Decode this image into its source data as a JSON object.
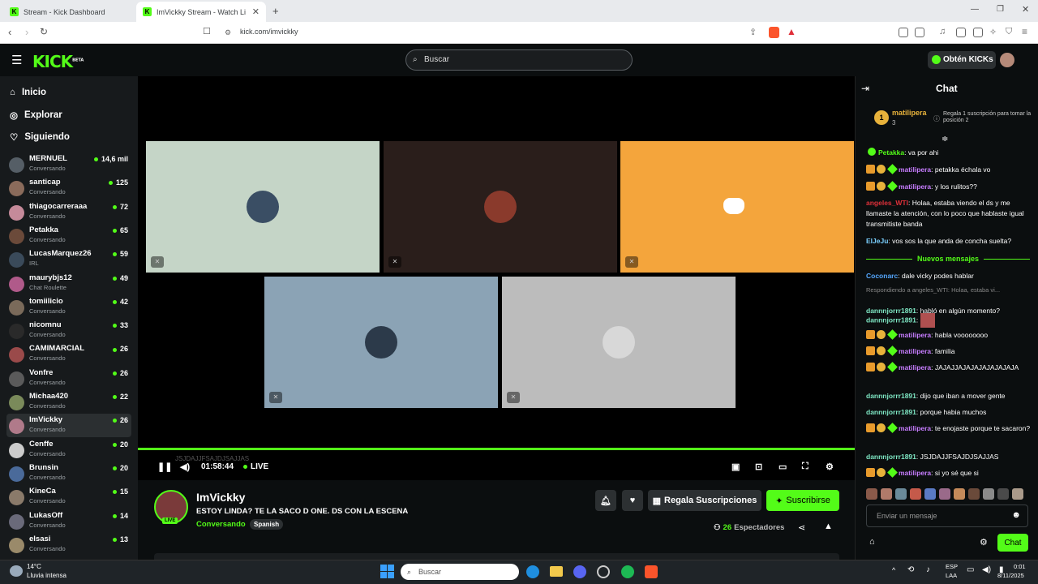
{
  "browser": {
    "tabs": [
      {
        "title": "Stream - Kick Dashboard"
      },
      {
        "title": "ImVickky Stream - Watch Live"
      }
    ],
    "url": "kick.com/imvickky",
    "new_tab": "+"
  },
  "header": {
    "logo": "KICK",
    "logo_badge": "BETA",
    "search_placeholder": "Buscar",
    "get_kicks": "Obtén KICKs"
  },
  "sidebar": {
    "nav": [
      {
        "label": "Inicio",
        "icon": "home-icon"
      },
      {
        "label": "Explorar",
        "icon": "compass-icon"
      },
      {
        "label": "Siguiendo",
        "icon": "heart-icon"
      }
    ],
    "channels": [
      {
        "name": "MERNUEL",
        "category": "Conversando",
        "viewers": "14,6 mil"
      },
      {
        "name": "santicap",
        "category": "Conversando",
        "viewers": "125"
      },
      {
        "name": "thiagocarreraaa",
        "category": "Conversando",
        "viewers": "72"
      },
      {
        "name": "Petakka",
        "category": "Conversando",
        "viewers": "65"
      },
      {
        "name": "LucasMarquez26",
        "category": "IRL",
        "viewers": "59"
      },
      {
        "name": "maurybjs12",
        "category": "Chat Roulette",
        "viewers": "49"
      },
      {
        "name": "tomiilicio",
        "category": "Conversando",
        "viewers": "42"
      },
      {
        "name": "nicomnu",
        "category": "Conversando",
        "viewers": "33"
      },
      {
        "name": "CAMIMARCIAL",
        "category": "Conversando",
        "viewers": "26"
      },
      {
        "name": "Vonfre",
        "category": "Conversando",
        "viewers": "26"
      },
      {
        "name": "Michaa420",
        "category": "Conversando",
        "viewers": "22"
      },
      {
        "name": "ImVickky",
        "category": "Conversando",
        "viewers": "26"
      },
      {
        "name": "Cenffe",
        "category": "Conversando",
        "viewers": "20"
      },
      {
        "name": "Brunsin",
        "category": "Conversando",
        "viewers": "20"
      },
      {
        "name": "KineCa",
        "category": "Conversando",
        "viewers": "15"
      },
      {
        "name": "LukasOff",
        "category": "Conversando",
        "viewers": "14"
      },
      {
        "name": "elsasi",
        "category": "Conversando",
        "viewers": "13"
      }
    ]
  },
  "player": {
    "time": "01:58:44",
    "live_label": "LIVE",
    "overlay_text": "JSJDAJJFSAJDJSAJJAS"
  },
  "stream": {
    "channel_name": "ImVickky",
    "title": "ESTOY LINDA? TE LA SACO D ONE. DS CON LA ESCENA",
    "category": "Conversando",
    "language": "Spanish",
    "live_badge": "LIVE",
    "gift_subs": "Regala Suscripciones",
    "subscribe": "Suscribirse",
    "viewers_count": "26",
    "viewers_label": "Espectadores"
  },
  "chat": {
    "title": "Chat",
    "top_gifter": {
      "rank": "1",
      "name": "matilipera",
      "count": "3",
      "note": "Regala 1 suscripción para tomar la posición 2"
    },
    "new_messages": "Nuevos mensajes",
    "input_placeholder": "Enviar un mensaje",
    "send": "Chat",
    "reply_hint": "Respondiendo a angeles_WTI: Holaa, estaba vi...",
    "messages": [
      {
        "user": "Petakka",
        "text": "va por ahi",
        "color": "#53fc18"
      },
      {
        "user": "matilipera",
        "text": "petakka échala vo",
        "color": "#c77dff"
      },
      {
        "user": "matilipera",
        "text": "y los rulitos??",
        "color": "#c77dff"
      },
      {
        "user": "angeles_WTI",
        "text": "Holaa, estaba viendo el ds y me llamaste la atención, con lo poco que hablaste igual transmitiste banda",
        "color": "#e0303a"
      },
      {
        "user": "ElJeJu",
        "text": "vos sos la que anda de concha suelta?",
        "color": "#7ad0ff"
      },
      {
        "user": "Coconarc",
        "text": "dale vicky podes hablar",
        "color": "#55a8ff"
      },
      {
        "user": "dannnjorrr1891",
        "text": "habló en algún momento?",
        "color": "#7fe8c5"
      },
      {
        "user": "dannnjorrr1891",
        "text": "",
        "color": "#7fe8c5"
      },
      {
        "user": "matilipera",
        "text": "habla voooooooo",
        "color": "#c77dff"
      },
      {
        "user": "matilipera",
        "text": "familia",
        "color": "#c77dff"
      },
      {
        "user": "matilipera",
        "text": "JAJAJJAJAJAJAJAJAJAJA",
        "color": "#c77dff"
      },
      {
        "user": "dannnjorrr1891",
        "text": "dijo que iban a mover gente",
        "color": "#7fe8c5"
      },
      {
        "user": "dannnjorrr1891",
        "text": "porque habia muchos",
        "color": "#7fe8c5"
      },
      {
        "user": "matilipera",
        "text": "te enojaste porque te sacaron?",
        "color": "#c77dff"
      },
      {
        "user": "dannnjorrr1891",
        "text": "JSJDAJJFSAJDJSAJJAS",
        "color": "#7fe8c5"
      },
      {
        "user": "matilipera",
        "text": "si yo sé que si",
        "color": "#c77dff"
      }
    ]
  },
  "taskbar": {
    "weather_temp": "14°C",
    "weather_desc": "Lluvia intensa",
    "search": "Buscar",
    "lang1": "ESP",
    "lang2": "LAA",
    "time": "0:01",
    "date": "8/11/2025"
  },
  "colors": {
    "accent": "#53fc18",
    "discord": "#f4a53c"
  }
}
